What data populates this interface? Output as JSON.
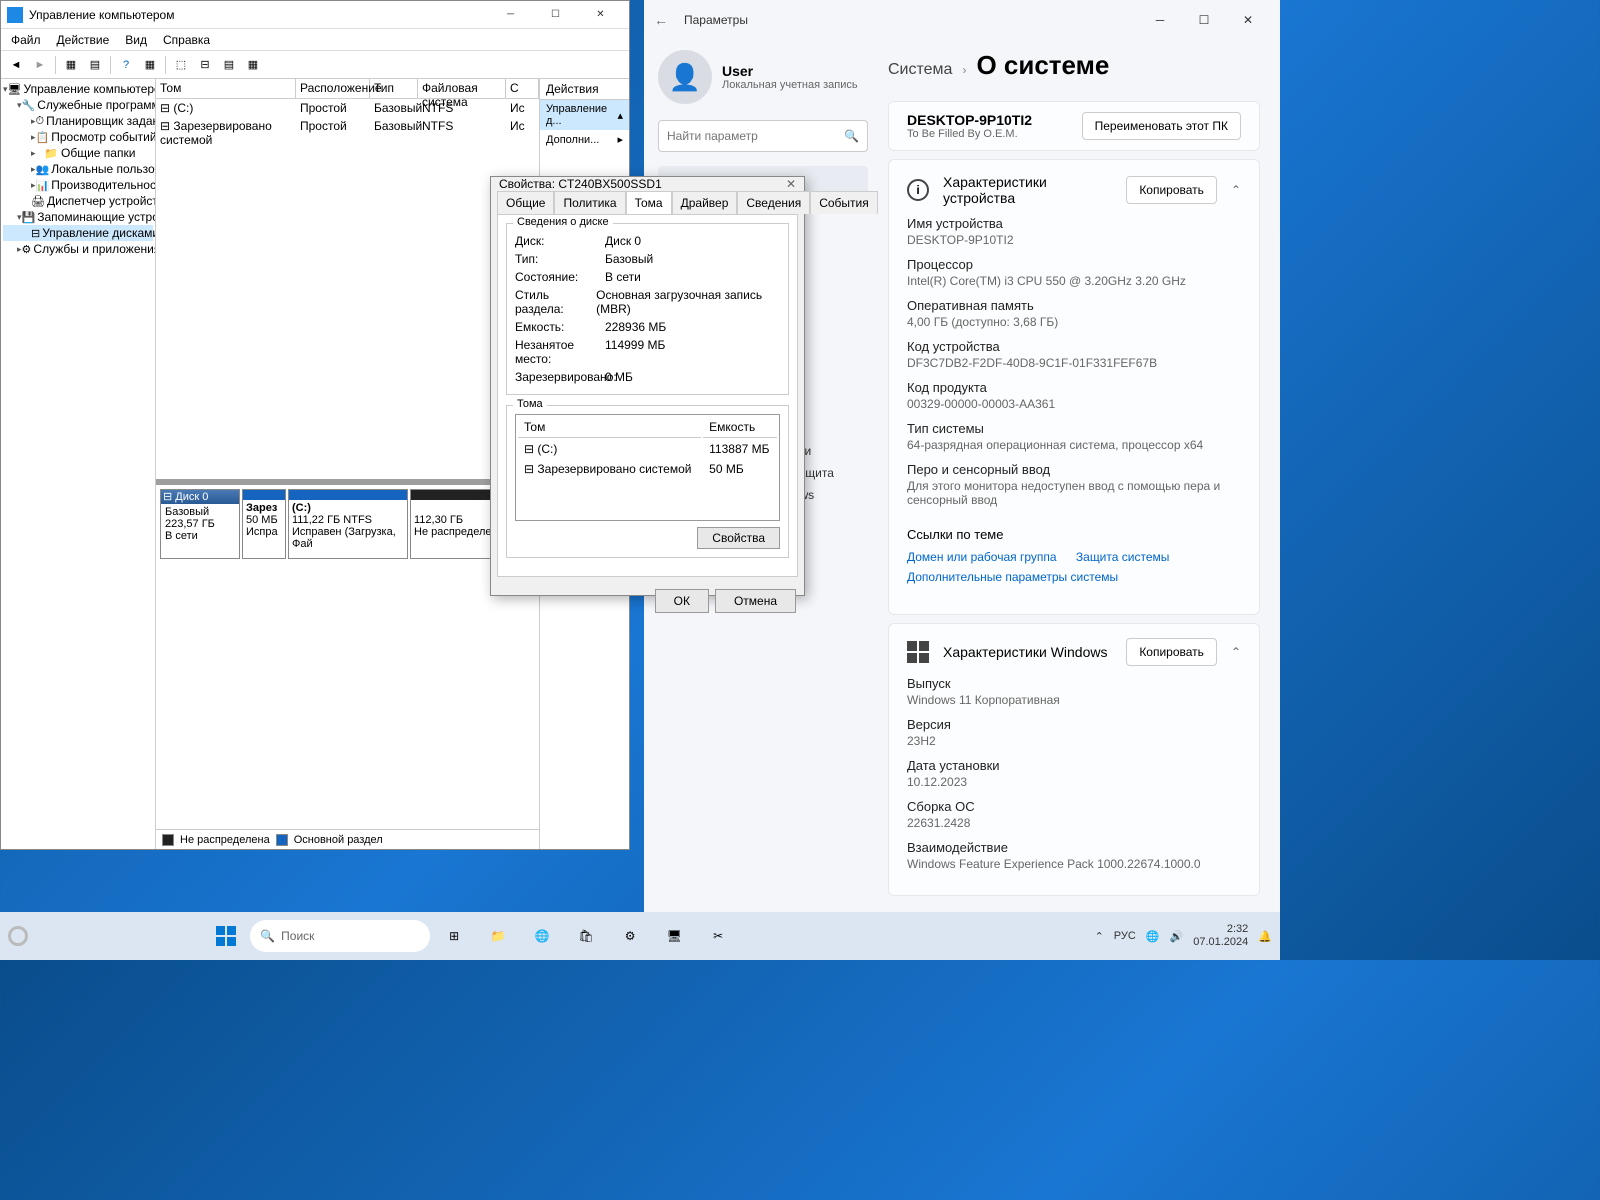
{
  "compmgmt": {
    "title": "Управление компьютером",
    "menu": [
      "Файл",
      "Действие",
      "Вид",
      "Справка"
    ],
    "tree": {
      "root": "Управление компьютером (л",
      "services_root": "Служебные программы",
      "services": [
        "Планировщик заданий",
        "Просмотр событий",
        "Общие папки",
        "Локальные пользова",
        "Производительность",
        "Диспетчер устройств"
      ],
      "storage_root": "Запоминающие устройст",
      "storage_item": "Управление дисками",
      "apps": "Службы и приложения"
    },
    "vol_headers": {
      "tom": "Том",
      "layout": "Расположение",
      "type": "Тип",
      "fs": "Файловая система",
      "status": "С"
    },
    "volumes": [
      {
        "tom": "(C:)",
        "layout": "Простой",
        "type": "Базовый",
        "fs": "NTFS",
        "status": "Ис"
      },
      {
        "tom": "Зарезервировано системой",
        "layout": "Простой",
        "type": "Базовый",
        "fs": "NTFS",
        "status": "Ис"
      }
    ],
    "actions_title": "Действия",
    "actions_item1": "Управление д...",
    "actions_item2": "Дополни...",
    "disk": {
      "label": "Диск 0",
      "type": "Базовый",
      "size": "223,57 ГБ",
      "status": "В сети",
      "parts": [
        {
          "name": "Зарез",
          "size": "50 МБ",
          "status": "Испра",
          "color": "#1565c0"
        },
        {
          "name": "(C:)",
          "sub": "111,22 ГБ NTFS",
          "status": "Исправен (Загрузка, Фай",
          "color": "#1565c0"
        },
        {
          "name": "",
          "sub": "112,30 ГБ",
          "status": "Не распределена",
          "color": "#222"
        }
      ]
    },
    "legend": {
      "unalloc": "Не распределена",
      "primary": "Основной раздел"
    }
  },
  "propdlg": {
    "title": "Свойства: CT240BX500SSD1",
    "tabs": [
      "Общие",
      "Политика",
      "Тома",
      "Драйвер",
      "Сведения",
      "События"
    ],
    "active_tab": 2,
    "group1_label": "Сведения о диске",
    "rows": [
      {
        "k": "Диск:",
        "v": "Диск 0"
      },
      {
        "k": "Тип:",
        "v": "Базовый"
      },
      {
        "k": "Состояние:",
        "v": "В сети"
      },
      {
        "k": "Стиль раздела:",
        "v": "Основная загрузочная запись (MBR)"
      },
      {
        "k": "Емкость:",
        "v": "228936 МБ"
      },
      {
        "k": "Незанятое место:",
        "v": "114999 МБ"
      },
      {
        "k": "Зарезервировано:",
        "v": "0 МБ"
      }
    ],
    "group2_label": "Тома",
    "vol_headers": {
      "tom": "Том",
      "cap": "Емкость"
    },
    "vols": [
      {
        "tom": "(C:)",
        "cap": "113887 МБ"
      },
      {
        "tom": "Зарезервировано системой",
        "cap": "50 МБ"
      }
    ],
    "props_btn": "Свойства",
    "ok": "ОК",
    "cancel": "Отмена"
  },
  "settings": {
    "app_title": "Параметры",
    "user_name": "User",
    "user_sub": "Локальная учетная запись",
    "search_ph": "Найти параметр",
    "nav_system": "Система",
    "nav_items_hidden": [
      "Специальные возможности",
      "Конфиденциальность и защита",
      "Центр обновления Windows"
    ],
    "breadcrumb_parent": "Система",
    "breadcrumb_current": "О системе",
    "device_name": "DESKTOP-9P10TI2",
    "device_sub": "To Be Filled By O.E.M.",
    "rename_btn": "Переименовать этот ПК",
    "spec_title": "Характеристики устройства",
    "copy_btn": "Копировать",
    "specs": [
      {
        "k": "Имя устройства",
        "v": "DESKTOP-9P10TI2"
      },
      {
        "k": "Процессор",
        "v": "Intel(R) Core(TM) i3 CPU         550  @ 3.20GHz   3.20 GHz"
      },
      {
        "k": "Оперативная память",
        "v": "4,00 ГБ (доступно: 3,68 ГБ)"
      },
      {
        "k": "Код устройства",
        "v": "DF3C7DB2-F2DF-40D8-9C1F-01F331FEF67B"
      },
      {
        "k": "Код продукта",
        "v": "00329-00000-00003-AA361"
      },
      {
        "k": "Тип системы",
        "v": "64-разрядная операционная система, процессор x64"
      },
      {
        "k": "Перо и сенсорный ввод",
        "v": "Для этого монитора недоступен ввод с помощью пера и сенсорный ввод"
      }
    ],
    "links_title": "Ссылки по теме",
    "links": [
      "Домен или рабочая группа",
      "Защита системы",
      "Дополнительные параметры системы"
    ],
    "win_title": "Характеристики Windows",
    "win_specs": [
      {
        "k": "Выпуск",
        "v": "Windows 11 Корпоративная"
      },
      {
        "k": "Версия",
        "v": "23H2"
      },
      {
        "k": "Дата установки",
        "v": "10.12.2023"
      },
      {
        "k": "Сборка ОС",
        "v": "22631.2428"
      },
      {
        "k": "Взаимодействие",
        "v": "Windows Feature Experience Pack 1000.22674.1000.0"
      }
    ]
  },
  "taskbar": {
    "search_ph": "Поиск",
    "lang": "РУС",
    "time": "2:32",
    "date": "07.01.2024"
  }
}
